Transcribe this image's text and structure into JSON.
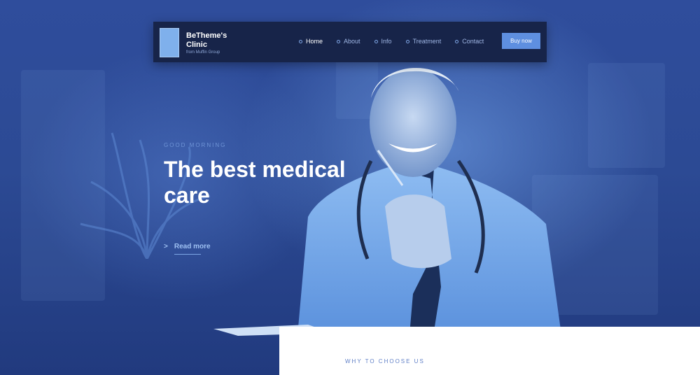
{
  "brand": {
    "title": "BeTheme's Clinic",
    "subtitle": "from Muffin Group"
  },
  "nav": {
    "items": [
      {
        "label": "Home",
        "active": true
      },
      {
        "label": "About",
        "active": false
      },
      {
        "label": "Info",
        "active": false
      },
      {
        "label": "Treatment",
        "active": false
      },
      {
        "label": "Contact",
        "active": false
      }
    ],
    "cta_label": "Buy now"
  },
  "hero": {
    "greeting": "GOOD MORNING",
    "headline": "The best medical care",
    "read_more": "Read more",
    "read_more_icon": "chevron-right-icon"
  },
  "section": {
    "title": "WHY TO CHOOSE US"
  },
  "colors": {
    "background": "#2c4a96",
    "navbar": "#172449",
    "accent": "#5e8fe0",
    "section_bg": "#ffffff"
  }
}
